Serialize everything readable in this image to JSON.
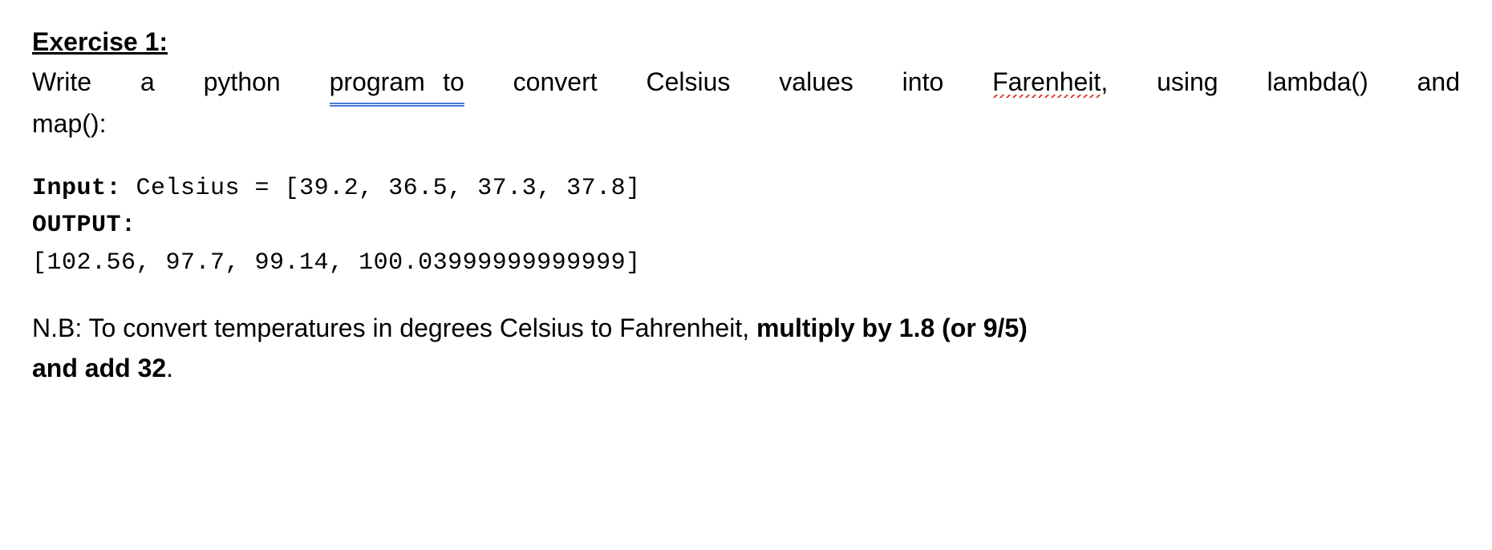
{
  "heading": "Exercise 1:",
  "para1": {
    "w1": "Write",
    "w2": "a",
    "w3": "python",
    "w4": "program",
    "w5_gap_to": "to",
    "w6": "convert",
    "w7": "Celsius",
    "w8": "values",
    "w9": "into",
    "w10": "Farenheit",
    "w10_comma": ",",
    "w11": "using",
    "w12": "lambda()",
    "w13": "and"
  },
  "para1_line2": "map():",
  "code": {
    "input_label": "Input:",
    "input_rest": " Celsius = [39.2, 36.5, 37.3, 37.8]",
    "output_label": "OUTPUT:",
    "output_list": "[102.56, 97.7, 99.14, 100.03999999999999]"
  },
  "nb": {
    "label": "N.B",
    "colon_text": ": To convert temperatures in degrees Celsius to Fahrenheit, ",
    "bold_part1": "multiply by 1.8 (or 9/5)",
    "bold_part2": "and add 32",
    "period": "."
  }
}
